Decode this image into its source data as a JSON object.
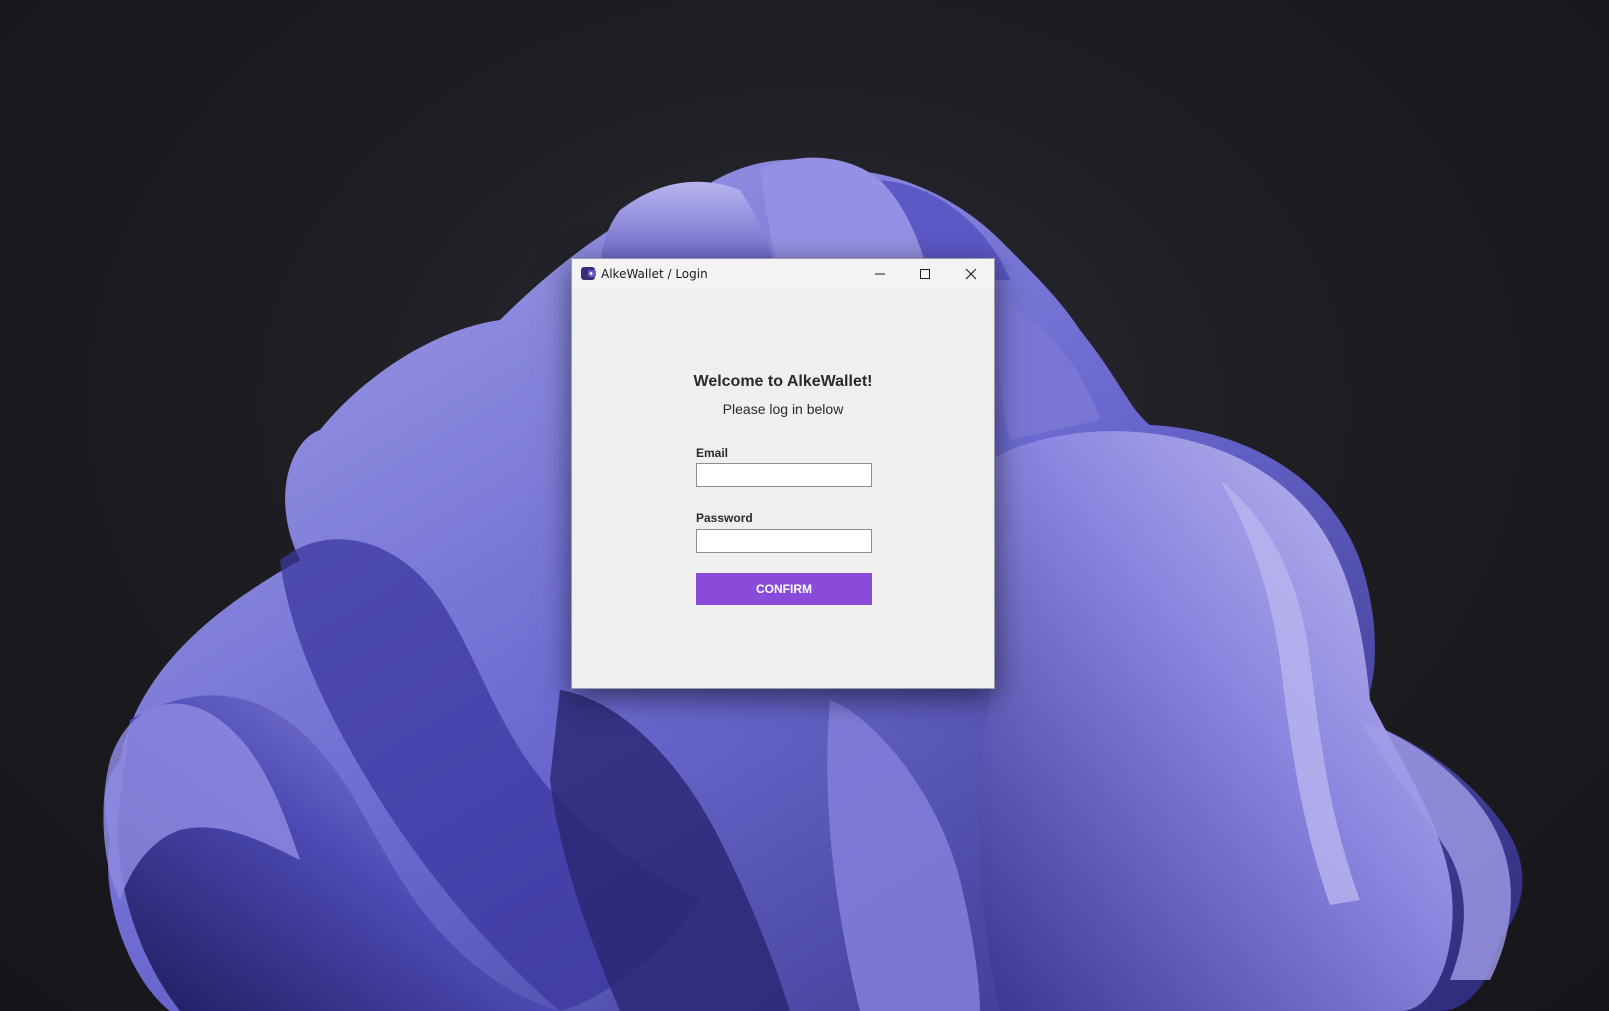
{
  "window": {
    "title": "AlkeWallet / Login",
    "icon": "wallet-icon",
    "controls": {
      "minimize_icon": "minimize-icon",
      "maximize_icon": "maximize-icon",
      "close_icon": "close-icon"
    }
  },
  "login": {
    "heading": "Welcome to AlkeWallet!",
    "subheading": "Please log in below",
    "email_label": "Email",
    "email_value": "",
    "password_label": "Password",
    "password_value": "",
    "confirm_label": "CONFIRM"
  },
  "colors": {
    "accent": "#8a4bdb",
    "window_bg": "#efefef",
    "titlebar_bg": "#f3f3f6",
    "desktop_bg": "#1d1d22",
    "wallpaper_petal": "#6a6ad0"
  }
}
